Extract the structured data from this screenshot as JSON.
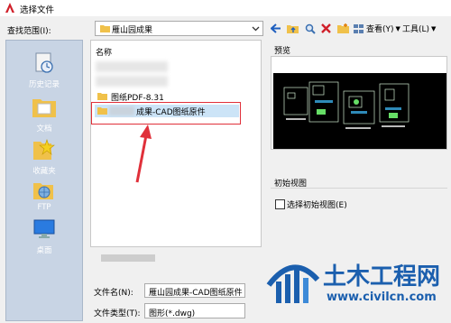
{
  "window": {
    "title": "选择文件"
  },
  "lookin": {
    "label": "查找范围(I):",
    "value": "雁山园成果"
  },
  "toolbar": {
    "view_label": "查看(Y)",
    "tools_label": "工具(L)"
  },
  "places": [
    {
      "label": "历史记录",
      "icon": "history-icon"
    },
    {
      "label": "文档",
      "icon": "documents-icon"
    },
    {
      "label": "收藏夹",
      "icon": "favorites-icon"
    },
    {
      "label": "FTP",
      "icon": "ftp-icon"
    },
    {
      "label": "桌面",
      "icon": "desktop-icon"
    }
  ],
  "filelist": {
    "column_name": "名称",
    "items": [
      {
        "name": "图纸PDF-8.31"
      },
      {
        "name": "成果-CAD图纸原件"
      }
    ]
  },
  "preview": {
    "label": "预览"
  },
  "initial_view": {
    "label": "初始视图",
    "checkbox_label": "选择初始视图(E)",
    "checked": false
  },
  "filename": {
    "label": "文件名(N):",
    "value": "雁山园成果-CAD图纸原件"
  },
  "filetype": {
    "label": "文件类型(T):",
    "value": "图形(*.dwg)"
  },
  "watermark": {
    "brand": "土木工程网",
    "url": "www.civilcn.com"
  },
  "colors": {
    "annotation": "#e0303a",
    "folder": "#f0c14a",
    "brand_blue": "#1b5fae"
  }
}
